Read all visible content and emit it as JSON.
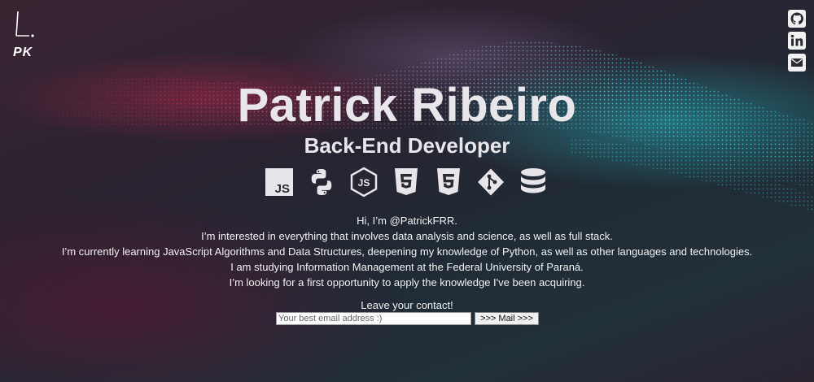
{
  "brand": {
    "logo_text": "PK"
  },
  "social": [
    {
      "icon": "github-icon"
    },
    {
      "icon": "linkedin-icon"
    },
    {
      "icon": "mail-icon"
    }
  ],
  "hero": {
    "name": "Patrick Ribeiro",
    "role": "Back-End Developer"
  },
  "tech_icons": [
    "javascript-icon",
    "python-icon",
    "nodejs-icon",
    "html5-icon",
    "css3-icon",
    "git-icon",
    "database-icon"
  ],
  "bio": {
    "lines": [
      "Hi, I’m @PatrickFRR.",
      "I’m interested in everything that involves data analysis and science, as well as full stack.",
      "I’m currently learning JavaScript Algorithms and Data Structures, deepening my knowledge of Python, as well as other languages and technologies.",
      "I am studying Information Management at the Federal University of Paraná.",
      "I’m looking for a first opportunity to apply the knowledge I've been acquiring."
    ]
  },
  "contact": {
    "label": "Leave your contact!",
    "email_placeholder": "Your best email address :)",
    "email_value": "",
    "submit_label": ">>> Mail >>>"
  }
}
